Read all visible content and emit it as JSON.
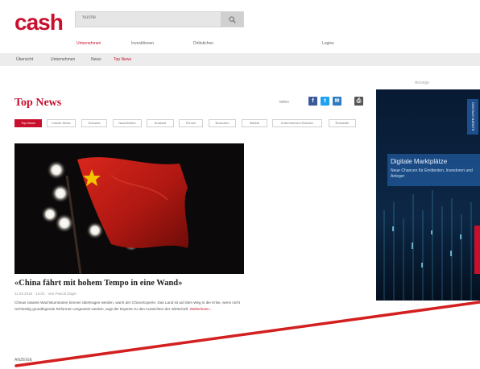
{
  "header": {
    "logo": "cash",
    "search_placeholder": "Suche"
  },
  "nav": {
    "items": [
      "Unternehmen",
      "Investitionen",
      "Drittstichen",
      "Logins"
    ]
  },
  "breadcrumb": [
    "Übersicht",
    "Unternehmen",
    "News",
    "Top News"
  ],
  "section": {
    "title": "Top News",
    "share_label": "teilen",
    "tabs": [
      "Top News",
      "Insider-News",
      "Schweiz",
      "Nachrichten",
      "Ausland",
      "Firmen",
      "Branchen",
      "Märkte",
      "Unternehmen-Schweiz",
      "Rohstoffe"
    ]
  },
  "article": {
    "headline": "«China fährt mit hohem Tempo in eine Wand»",
    "meta": "11.03.2016 · 14:01 · Von Pascal Züger",
    "teaser": "Chinas rasante Wachstumsraten können übertragen werden, warnt der China-Experte. Das Land ist auf dem Weg in die Krise, wenn nicht rechtzeitig grundlegende Reformen umgesetzt werden, sagt der Experte zu den Aussichten der Wirtschaft.",
    "more": "Weiterlesen..."
  },
  "ad": {
    "label": "Anzeige",
    "tab": "DIGITALE MÄRKTE",
    "title": "Digitale Marktplätze",
    "subtitle": "Neue Chancen für Emittenten, Investoren und Anleger"
  },
  "footer": {
    "label": "ANZEIGE"
  },
  "colors": {
    "brand_red": "#c8102e",
    "facebook": "#3b5998",
    "twitter": "#1da1f2"
  },
  "icons": [
    "search-icon",
    "facebook-icon",
    "twitter-icon",
    "mail-icon",
    "print-icon"
  ]
}
